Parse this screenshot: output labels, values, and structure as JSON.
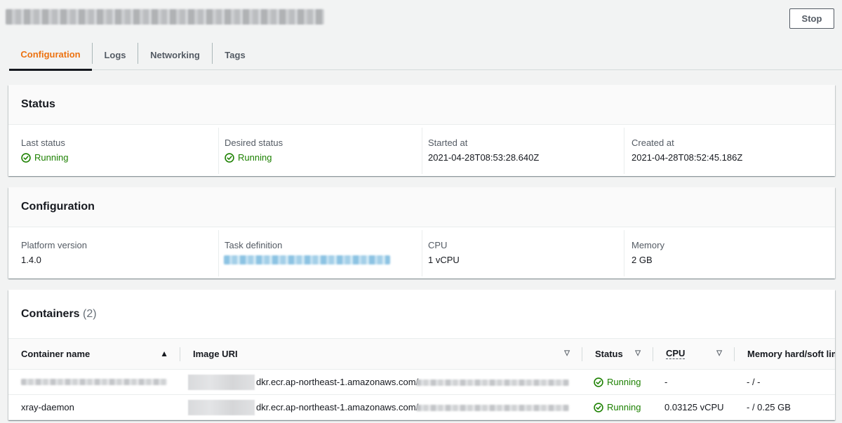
{
  "header": {
    "stop_label": "Stop"
  },
  "tabs": [
    {
      "label": "Configuration",
      "active": true
    },
    {
      "label": "Logs"
    },
    {
      "label": "Networking"
    },
    {
      "label": "Tags"
    }
  ],
  "status_section": {
    "title": "Status",
    "fields": {
      "last_status": {
        "label": "Last status",
        "value": "Running"
      },
      "desired_status": {
        "label": "Desired status",
        "value": "Running"
      },
      "started_at": {
        "label": "Started at",
        "value": "2021-04-28T08:53:28.640Z"
      },
      "created_at": {
        "label": "Created at",
        "value": "2021-04-28T08:52:45.186Z"
      }
    }
  },
  "configuration_section": {
    "title": "Configuration",
    "fields": {
      "platform_version": {
        "label": "Platform version",
        "value": "1.4.0"
      },
      "task_definition": {
        "label": "Task definition"
      },
      "cpu": {
        "label": "CPU",
        "value": "1 vCPU"
      },
      "memory": {
        "label": "Memory",
        "value": "2 GB"
      }
    }
  },
  "containers_section": {
    "title": "Containers",
    "count": "(2)",
    "columns": {
      "name": "Container name",
      "image": "Image URI",
      "status": "Status",
      "cpu": "CPU",
      "memory": "Memory hard/soft limits"
    },
    "rows": [
      {
        "image_mid": "dkr.ecr.ap-northeast-1.amazonaws.com/",
        "status": "Running",
        "cpu": "-",
        "memory": "- / -"
      },
      {
        "name": "xray-daemon",
        "image_mid": "dkr.ecr.ap-northeast-1.amazonaws.com/",
        "status": "Running",
        "cpu": "0.03125 vCPU",
        "memory": "- / 0.25 GB"
      }
    ]
  },
  "colors": {
    "accent": "#ec7211",
    "success": "#1d8102",
    "link": "#0073bb"
  },
  "icons": {
    "status_ok": "check-circle-icon",
    "sort_asc": "caret-up-icon",
    "sort_none": "caret-down-outline-icon"
  }
}
